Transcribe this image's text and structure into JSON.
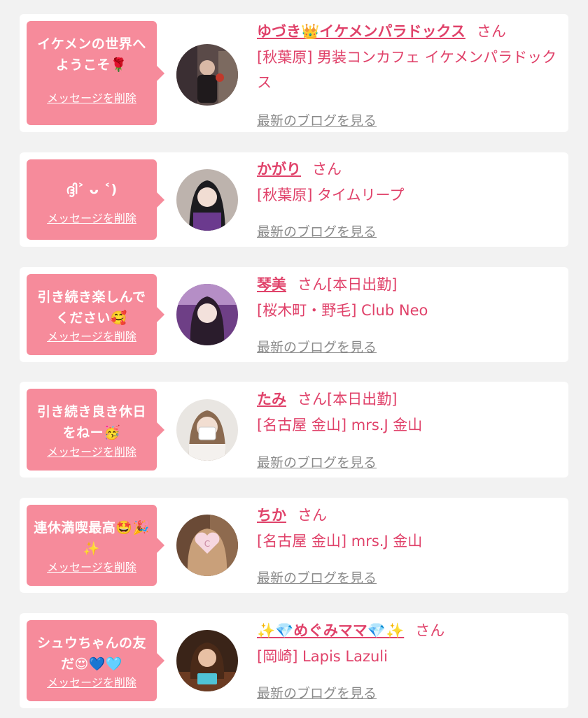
{
  "delete_label": "メッセージを削除",
  "blog_label": "最新のブログを見る",
  "honorific": "さん",
  "colors": {
    "accent": "#e0426a",
    "bubble": "#f68b9b",
    "link_gray": "#8a8a8a",
    "background": "#f2f2f2"
  },
  "items": [
    {
      "message": "イケメンの世界へようこそ🌹",
      "name": "ゆづき👑イケメンパラドックス",
      "status": "",
      "shop": "[秋葉原] 男装コンカフェ イケメンパラドックス",
      "avatar_icon": "profile-photo-icon"
    },
    {
      "message": "ദ്ദി˃ ᴗ ˂)",
      "name": "かがり",
      "status": "",
      "shop": "[秋葉原] タイムリープ",
      "avatar_icon": "profile-photo-icon"
    },
    {
      "message": "引き続き楽しんでください🥰",
      "name": "琴美",
      "status": "[本日出勤]",
      "shop": "[桜木町・野毛] Club Neo",
      "avatar_icon": "profile-photo-icon"
    },
    {
      "message": "引き続き良き休日をねー🥳",
      "name": "たみ",
      "status": "[本日出勤]",
      "shop": "[名古屋 金山] mrs.J 金山",
      "avatar_icon": "profile-photo-icon"
    },
    {
      "message": "連休満喫最高🤩🎉✨",
      "name": "ちか",
      "status": "",
      "shop": "[名古屋 金山] mrs.J 金山",
      "avatar_icon": "profile-photo-icon"
    },
    {
      "message": "シュウちゃんの友だ😍💙🩵",
      "name": "✨💎めぐみママ💎✨",
      "status": "",
      "shop": "[岡崎] Lapis Lazuli",
      "avatar_icon": "profile-photo-icon"
    }
  ]
}
